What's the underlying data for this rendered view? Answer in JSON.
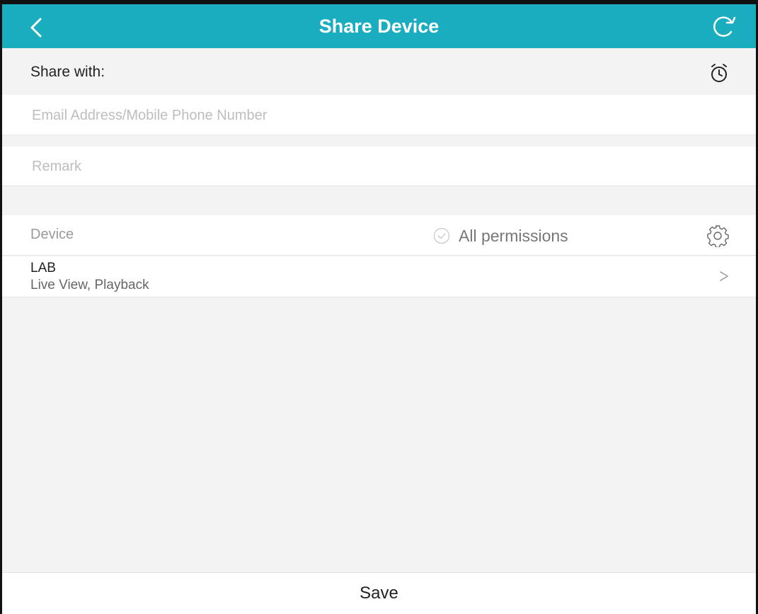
{
  "header": {
    "title": "Share Device",
    "back_icon": "chevron-left-icon",
    "refresh_icon": "refresh-icon",
    "background_color": "#1aacbf"
  },
  "share": {
    "label": "Share with:",
    "timer_icon": "alarm-clock-icon",
    "email_placeholder": "Email Address/Mobile Phone Number",
    "email_value": "",
    "remark_placeholder": "Remark",
    "remark_value": ""
  },
  "device_section": {
    "label": "Device",
    "all_permissions_label": "All permissions",
    "all_permissions_checked": false,
    "settings_icon": "gear-icon"
  },
  "devices": [
    {
      "name": "LAB",
      "permissions": "Live View, Playback"
    }
  ],
  "footer": {
    "save_label": "Save"
  }
}
